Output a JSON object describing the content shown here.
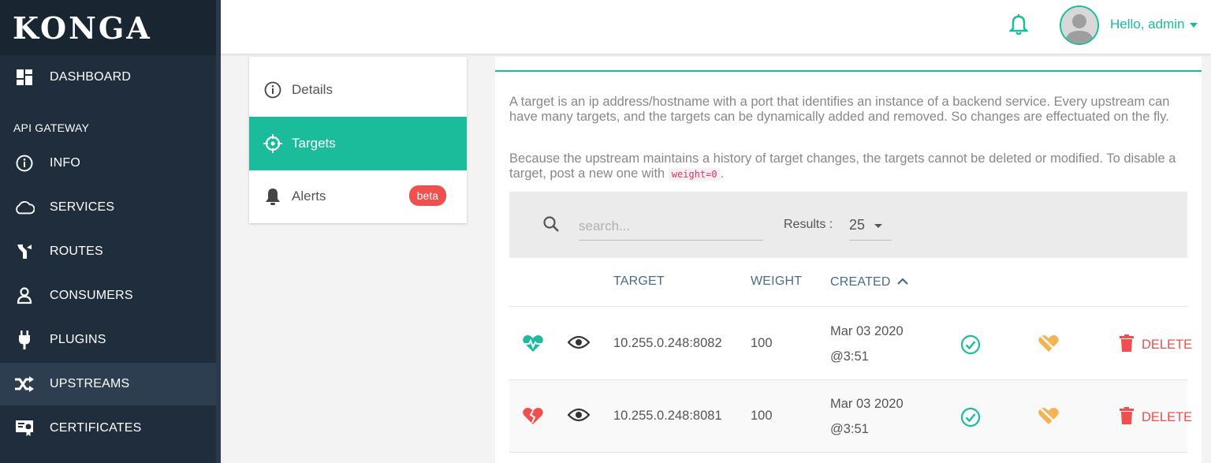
{
  "brand": {
    "name": "KONGA"
  },
  "colors": {
    "accent": "#1abc9c",
    "danger": "#ef4f4f",
    "warning": "#f5a623",
    "sidebar": "#1f2d3d"
  },
  "topbar": {
    "greeting": "Hello, admin",
    "bell_icon": "bell-icon",
    "avatar_icon": "user-avatar"
  },
  "sidebar": {
    "dashboard": "DASHBOARD",
    "section": "API GATEWAY",
    "items": [
      {
        "label": "INFO",
        "icon": "info-circle-icon"
      },
      {
        "label": "SERVICES",
        "icon": "cloud-icon"
      },
      {
        "label": "ROUTES",
        "icon": "route-fork-icon"
      },
      {
        "label": "CONSUMERS",
        "icon": "user-icon"
      },
      {
        "label": "PLUGINS",
        "icon": "plug-icon"
      },
      {
        "label": "UPSTREAMS",
        "icon": "shuffle-icon",
        "active": true
      },
      {
        "label": "CERTIFICATES",
        "icon": "certificate-icon"
      }
    ]
  },
  "tabs": [
    {
      "label": "Details",
      "icon": "info-circle-icon"
    },
    {
      "label": "Targets",
      "icon": "crosshair-icon",
      "active": true
    },
    {
      "label": "Alerts",
      "icon": "bell-icon",
      "badge": "beta"
    }
  ],
  "main": {
    "desc1": "A target is an ip address/hostname with a port that identifies an instance of a backend service. Every upstream can have many targets, and the targets can be dynamically added and removed. So changes are effectuated on the fly.",
    "desc2_prefix": "Because the upstream maintains a history of target changes, the targets cannot be deleted or modified. To disable a target, post a new one with ",
    "desc2_code": "weight=0",
    "desc2_suffix": "."
  },
  "toolbar": {
    "search_placeholder": "search...",
    "results_label": "Results :",
    "results_value": "25"
  },
  "table": {
    "headers": {
      "target": "TARGET",
      "weight": "WEIGHT",
      "created": "CREATED"
    },
    "rows": [
      {
        "health_icon": "heartbeat-icon",
        "target": "10.255.0.248:8082",
        "weight": "100",
        "created_date": "Mar 03 2020",
        "created_time": "@3:51",
        "delete_label": "DELETE"
      },
      {
        "health_icon": "broken-heart-icon",
        "target": "10.255.0.248:8081",
        "weight": "100",
        "created_date": "Mar 03 2020",
        "created_time": "@3:51",
        "delete_label": "DELETE"
      }
    ]
  }
}
